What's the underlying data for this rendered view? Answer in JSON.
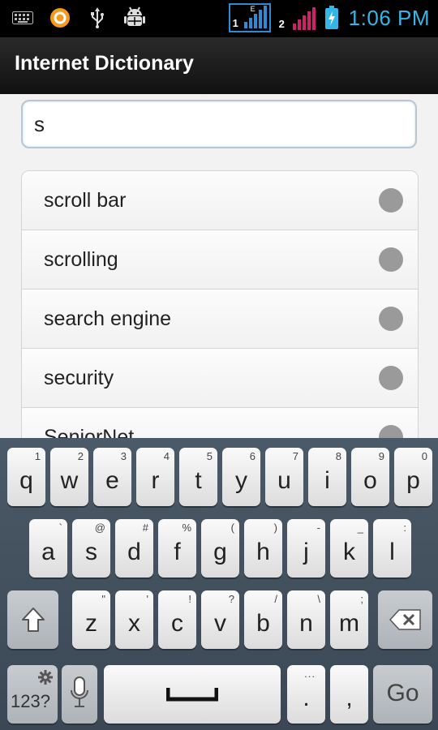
{
  "status_bar": {
    "icons": [
      "keyboard-icon",
      "ring-app-icon",
      "usb-icon",
      "android-debug-icon"
    ],
    "sim1": {
      "label": "1",
      "network": "E"
    },
    "sim2": {
      "label": "2"
    },
    "time": "1:06 PM",
    "colors": {
      "sim1_signal": "#2e8bd3",
      "sim2_signal": "#d0206a",
      "battery": "#35b6e8",
      "clock": "#35b6e8"
    }
  },
  "app": {
    "title": "Internet Dictionary"
  },
  "search": {
    "value": "s",
    "placeholder": ""
  },
  "results": [
    {
      "label": "scroll bar"
    },
    {
      "label": "scrolling"
    },
    {
      "label": "search engine"
    },
    {
      "label": "security"
    },
    {
      "label": "SeniorNet"
    }
  ],
  "keyboard": {
    "row1": [
      {
        "key": "q",
        "sup": "1"
      },
      {
        "key": "w",
        "sup": "2"
      },
      {
        "key": "e",
        "sup": "3"
      },
      {
        "key": "r",
        "sup": "4"
      },
      {
        "key": "t",
        "sup": "5"
      },
      {
        "key": "y",
        "sup": "6"
      },
      {
        "key": "u",
        "sup": "7"
      },
      {
        "key": "i",
        "sup": "8"
      },
      {
        "key": "o",
        "sup": "9"
      },
      {
        "key": "p",
        "sup": "0"
      }
    ],
    "row2": [
      {
        "key": "a",
        "sup": "`"
      },
      {
        "key": "s",
        "sup": "@"
      },
      {
        "key": "d",
        "sup": "#"
      },
      {
        "key": "f",
        "sup": "%"
      },
      {
        "key": "g",
        "sup": "("
      },
      {
        "key": "h",
        "sup": ")"
      },
      {
        "key": "j",
        "sup": "-"
      },
      {
        "key": "k",
        "sup": "_"
      },
      {
        "key": "l",
        "sup": ":"
      }
    ],
    "row3": [
      {
        "key": "z",
        "sup": "\""
      },
      {
        "key": "x",
        "sup": "'"
      },
      {
        "key": "c",
        "sup": "!"
      },
      {
        "key": "v",
        "sup": "?"
      },
      {
        "key": "b",
        "sup": "/"
      },
      {
        "key": "n",
        "sup": "\\"
      },
      {
        "key": "m",
        "sup": ";"
      }
    ],
    "symbols_key": "123?",
    "period": {
      "key": ".",
      "sup": "..."
    },
    "comma": {
      "key": ","
    },
    "go": "Go"
  }
}
